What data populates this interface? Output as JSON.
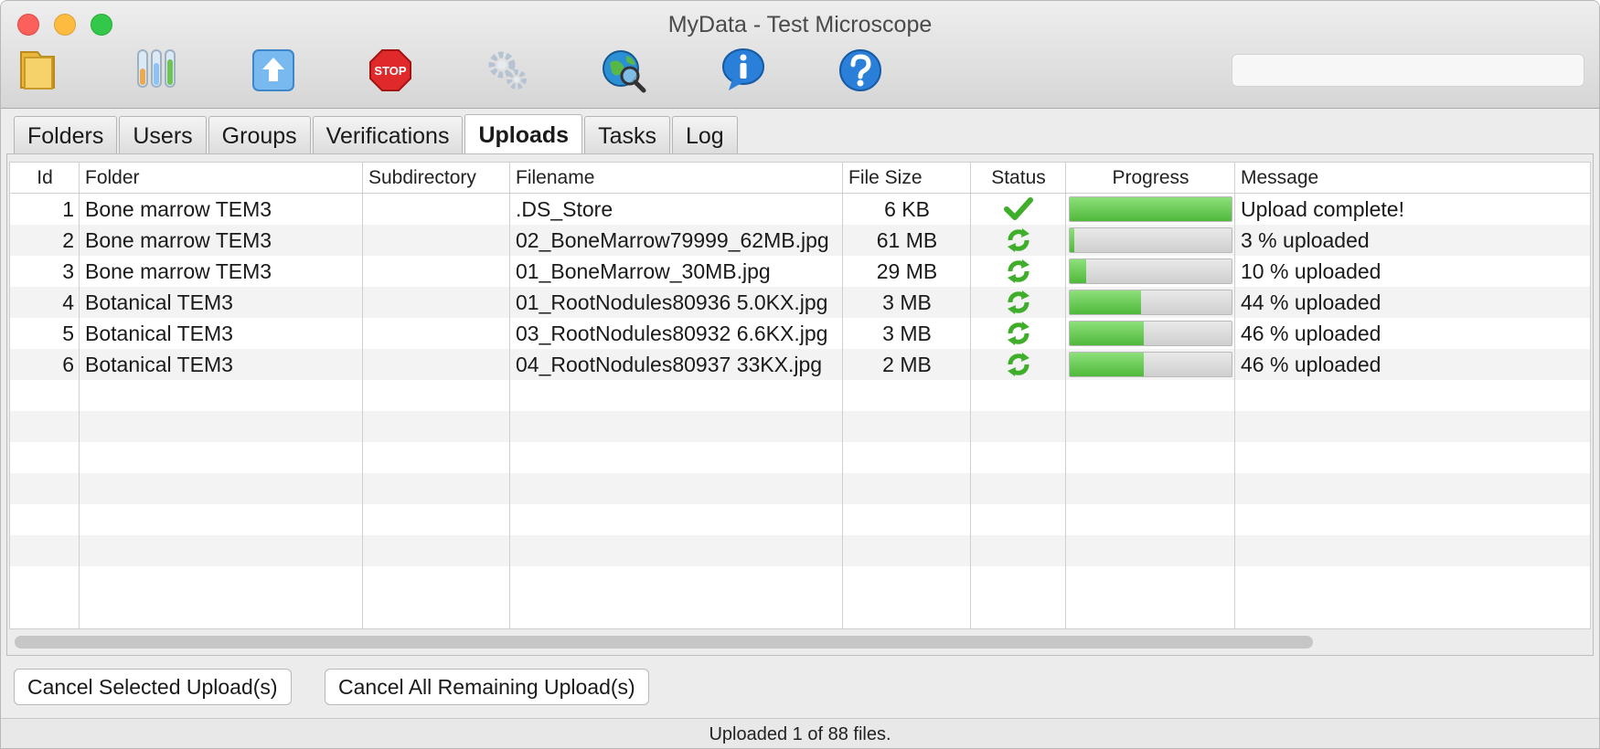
{
  "window": {
    "title": "MyData - Test Microscope"
  },
  "toolbar": {
    "tools": [
      {
        "name": "open-folder-icon"
      },
      {
        "name": "test-tubes-icon"
      },
      {
        "name": "upload-arrow-icon"
      },
      {
        "name": "stop-sign-icon",
        "label": "STOP"
      },
      {
        "name": "gears-icon"
      },
      {
        "name": "globe-search-icon"
      },
      {
        "name": "info-bubble-icon"
      },
      {
        "name": "help-icon"
      }
    ],
    "search_value": ""
  },
  "tabs": [
    "Folders",
    "Users",
    "Groups",
    "Verifications",
    "Uploads",
    "Tasks",
    "Log"
  ],
  "active_tab": "Uploads",
  "table": {
    "columns": [
      "Id",
      "Folder",
      "Subdirectory",
      "Filename",
      "File Size",
      "Status",
      "Progress",
      "Message"
    ],
    "rows": [
      {
        "id": "1",
        "folder": "Bone marrow TEM3",
        "subdirectory": "",
        "filename": ".DS_Store",
        "size": "6 KB",
        "status": "checkmark-icon",
        "progress": 100,
        "message": "Upload complete!"
      },
      {
        "id": "2",
        "folder": "Bone marrow TEM3",
        "subdirectory": "",
        "filename": "02_BoneMarrow79999_62MB.jpg",
        "size": "61 MB",
        "status": "refresh-icon",
        "progress": 3,
        "message": "3 %  uploaded"
      },
      {
        "id": "3",
        "folder": "Bone marrow TEM3",
        "subdirectory": "",
        "filename": "01_BoneMarrow_30MB.jpg",
        "size": "29 MB",
        "status": "refresh-icon",
        "progress": 10,
        "message": "10 %  uploaded"
      },
      {
        "id": "4",
        "folder": "Botanical TEM3",
        "subdirectory": "",
        "filename": "01_RootNodules80936 5.0KX.jpg",
        "size": "3 MB",
        "status": "refresh-icon",
        "progress": 44,
        "message": "44 %  uploaded"
      },
      {
        "id": "5",
        "folder": "Botanical TEM3",
        "subdirectory": "",
        "filename": "03_RootNodules80932 6.6KX.jpg",
        "size": "3 MB",
        "status": "refresh-icon",
        "progress": 46,
        "message": "46 %  uploaded"
      },
      {
        "id": "6",
        "folder": "Botanical TEM3",
        "subdirectory": "",
        "filename": "04_RootNodules80937 33KX.jpg",
        "size": "2 MB",
        "status": "refresh-icon",
        "progress": 46,
        "message": "46 %  uploaded"
      }
    ]
  },
  "buttons": {
    "cancel_selected": "Cancel Selected Upload(s)",
    "cancel_all": "Cancel All Remaining Upload(s)"
  },
  "statusbar": {
    "text": "Uploaded 1 of 88 files."
  },
  "colors": {
    "progress_green": "#4fb93b",
    "accent_blue": "#2a7fd8"
  }
}
